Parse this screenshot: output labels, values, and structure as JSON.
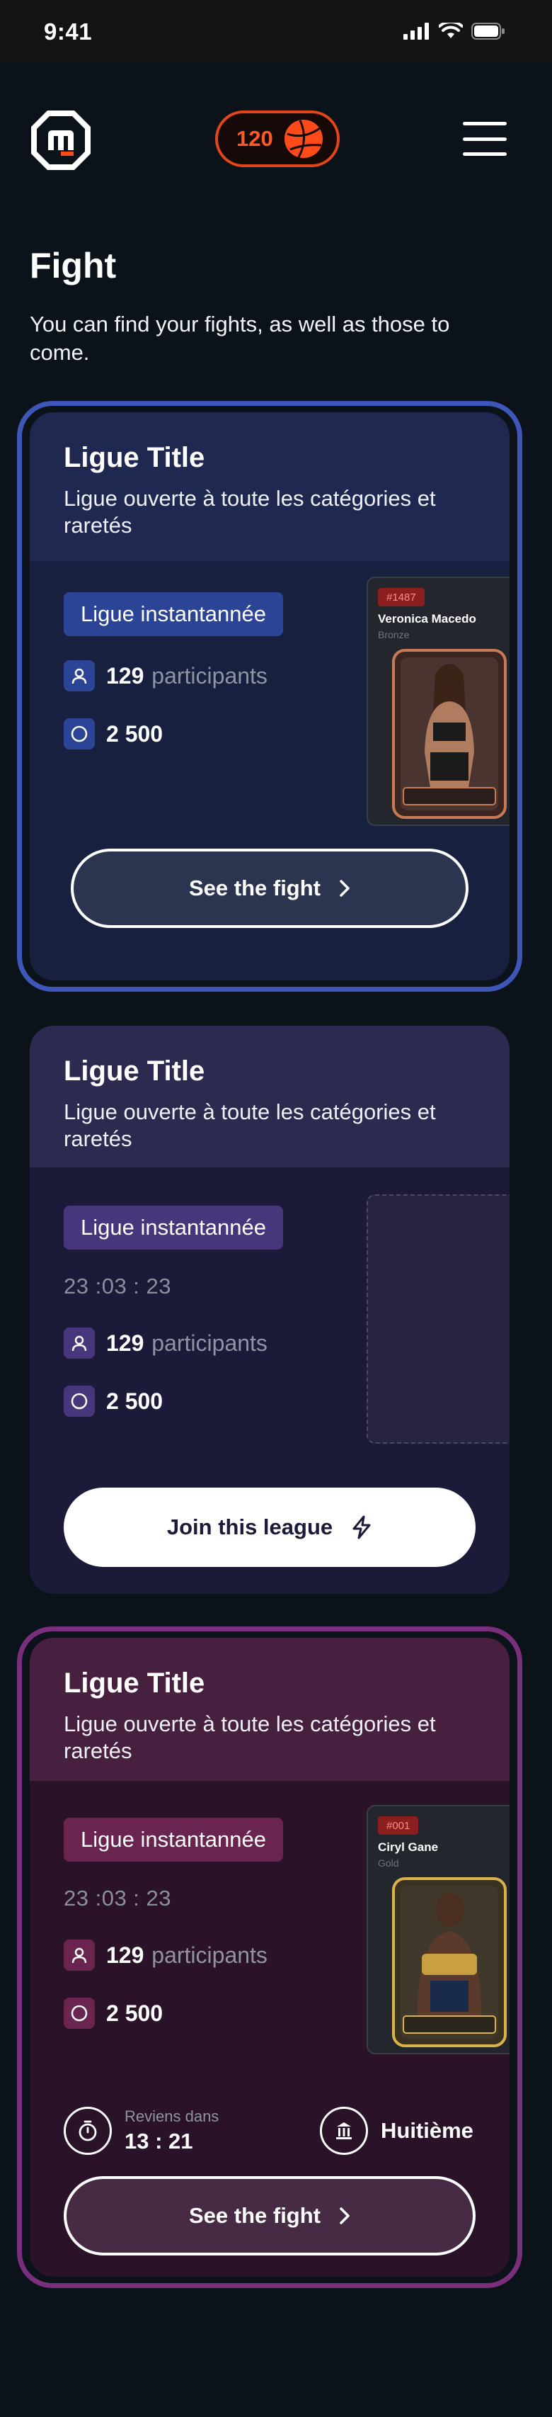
{
  "status_bar": {
    "time": "9:41"
  },
  "header": {
    "coins": "120"
  },
  "page": {
    "title": "Fight",
    "subtitle": "You can find your fights, as well as those to come."
  },
  "cards": [
    {
      "title": "Ligue Title",
      "description": "Ligue ouverte à toute les catégories et raretés",
      "badge": "Ligue instantannée",
      "participants_count": "129",
      "participants_label": "participants",
      "prize": "2 500",
      "player": {
        "number": "#1487",
        "name": "Veronica Macedo",
        "rarity": "Bronze"
      },
      "button": "See the fight",
      "colors": {
        "outline": "#3d56b8",
        "head": "#1f2850",
        "body": "#182040",
        "badge": "#2b4496"
      }
    },
    {
      "title": "Ligue Title",
      "description": "Ligue ouverte à toute les catégories et raretés",
      "badge": "Ligue instantannée",
      "timer": "23 :03 : 23",
      "participants_count": "129",
      "participants_label": "participants",
      "prize": "2 500",
      "button": "Join this league",
      "colors": {
        "head": "#2d2a50",
        "body": "#1b1a38",
        "badge": "#48367c"
      }
    },
    {
      "title": "Ligue Title",
      "description": "Ligue ouverte à toute les catégories et raretés",
      "badge": "Ligue instantannée",
      "timer": "23 :03 : 23",
      "participants_count": "129",
      "participants_label": "participants",
      "prize": "2 500",
      "player": {
        "number": "#001",
        "name": "Ciryl Gane",
        "rarity": "Gold"
      },
      "return_label": "Reviens dans",
      "return_time": "13 : 21",
      "round": "Huitième",
      "button": "See the fight",
      "colors": {
        "outline": "#7a2f7c",
        "head": "#47203f",
        "body": "#2a1228",
        "badge": "#6a2450"
      }
    }
  ]
}
